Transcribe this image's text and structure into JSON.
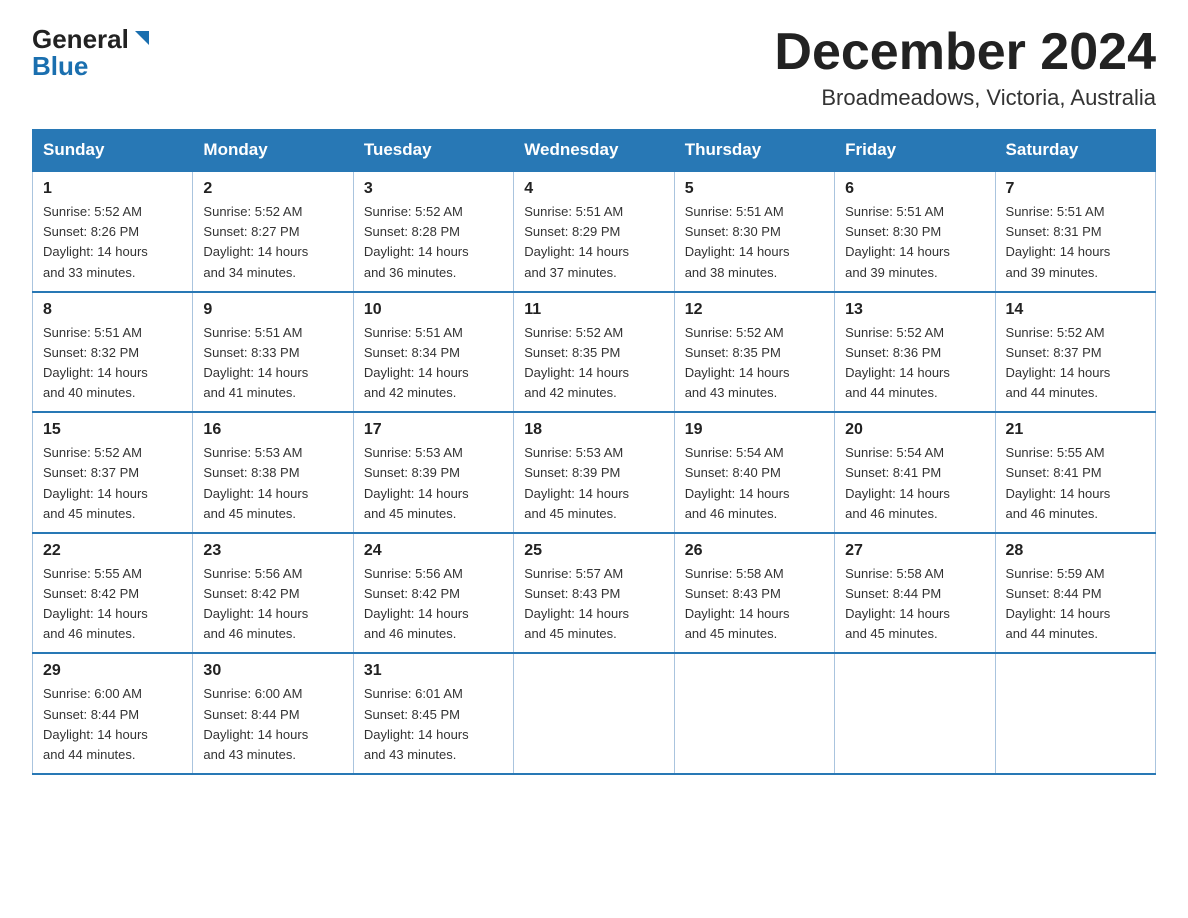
{
  "header": {
    "logo_general": "General",
    "logo_blue": "Blue",
    "month_title": "December 2024",
    "location": "Broadmeadows, Victoria, Australia"
  },
  "weekdays": [
    "Sunday",
    "Monday",
    "Tuesday",
    "Wednesday",
    "Thursday",
    "Friday",
    "Saturday"
  ],
  "weeks": [
    [
      {
        "day": "1",
        "sunrise": "5:52 AM",
        "sunset": "8:26 PM",
        "daylight": "14 hours and 33 minutes."
      },
      {
        "day": "2",
        "sunrise": "5:52 AM",
        "sunset": "8:27 PM",
        "daylight": "14 hours and 34 minutes."
      },
      {
        "day": "3",
        "sunrise": "5:52 AM",
        "sunset": "8:28 PM",
        "daylight": "14 hours and 36 minutes."
      },
      {
        "day": "4",
        "sunrise": "5:51 AM",
        "sunset": "8:29 PM",
        "daylight": "14 hours and 37 minutes."
      },
      {
        "day": "5",
        "sunrise": "5:51 AM",
        "sunset": "8:30 PM",
        "daylight": "14 hours and 38 minutes."
      },
      {
        "day": "6",
        "sunrise": "5:51 AM",
        "sunset": "8:30 PM",
        "daylight": "14 hours and 39 minutes."
      },
      {
        "day": "7",
        "sunrise": "5:51 AM",
        "sunset": "8:31 PM",
        "daylight": "14 hours and 39 minutes."
      }
    ],
    [
      {
        "day": "8",
        "sunrise": "5:51 AM",
        "sunset": "8:32 PM",
        "daylight": "14 hours and 40 minutes."
      },
      {
        "day": "9",
        "sunrise": "5:51 AM",
        "sunset": "8:33 PM",
        "daylight": "14 hours and 41 minutes."
      },
      {
        "day": "10",
        "sunrise": "5:51 AM",
        "sunset": "8:34 PM",
        "daylight": "14 hours and 42 minutes."
      },
      {
        "day": "11",
        "sunrise": "5:52 AM",
        "sunset": "8:35 PM",
        "daylight": "14 hours and 42 minutes."
      },
      {
        "day": "12",
        "sunrise": "5:52 AM",
        "sunset": "8:35 PM",
        "daylight": "14 hours and 43 minutes."
      },
      {
        "day": "13",
        "sunrise": "5:52 AM",
        "sunset": "8:36 PM",
        "daylight": "14 hours and 44 minutes."
      },
      {
        "day": "14",
        "sunrise": "5:52 AM",
        "sunset": "8:37 PM",
        "daylight": "14 hours and 44 minutes."
      }
    ],
    [
      {
        "day": "15",
        "sunrise": "5:52 AM",
        "sunset": "8:37 PM",
        "daylight": "14 hours and 45 minutes."
      },
      {
        "day": "16",
        "sunrise": "5:53 AM",
        "sunset": "8:38 PM",
        "daylight": "14 hours and 45 minutes."
      },
      {
        "day": "17",
        "sunrise": "5:53 AM",
        "sunset": "8:39 PM",
        "daylight": "14 hours and 45 minutes."
      },
      {
        "day": "18",
        "sunrise": "5:53 AM",
        "sunset": "8:39 PM",
        "daylight": "14 hours and 45 minutes."
      },
      {
        "day": "19",
        "sunrise": "5:54 AM",
        "sunset": "8:40 PM",
        "daylight": "14 hours and 46 minutes."
      },
      {
        "day": "20",
        "sunrise": "5:54 AM",
        "sunset": "8:41 PM",
        "daylight": "14 hours and 46 minutes."
      },
      {
        "day": "21",
        "sunrise": "5:55 AM",
        "sunset": "8:41 PM",
        "daylight": "14 hours and 46 minutes."
      }
    ],
    [
      {
        "day": "22",
        "sunrise": "5:55 AM",
        "sunset": "8:42 PM",
        "daylight": "14 hours and 46 minutes."
      },
      {
        "day": "23",
        "sunrise": "5:56 AM",
        "sunset": "8:42 PM",
        "daylight": "14 hours and 46 minutes."
      },
      {
        "day": "24",
        "sunrise": "5:56 AM",
        "sunset": "8:42 PM",
        "daylight": "14 hours and 46 minutes."
      },
      {
        "day": "25",
        "sunrise": "5:57 AM",
        "sunset": "8:43 PM",
        "daylight": "14 hours and 45 minutes."
      },
      {
        "day": "26",
        "sunrise": "5:58 AM",
        "sunset": "8:43 PM",
        "daylight": "14 hours and 45 minutes."
      },
      {
        "day": "27",
        "sunrise": "5:58 AM",
        "sunset": "8:44 PM",
        "daylight": "14 hours and 45 minutes."
      },
      {
        "day": "28",
        "sunrise": "5:59 AM",
        "sunset": "8:44 PM",
        "daylight": "14 hours and 44 minutes."
      }
    ],
    [
      {
        "day": "29",
        "sunrise": "6:00 AM",
        "sunset": "8:44 PM",
        "daylight": "14 hours and 44 minutes."
      },
      {
        "day": "30",
        "sunrise": "6:00 AM",
        "sunset": "8:44 PM",
        "daylight": "14 hours and 43 minutes."
      },
      {
        "day": "31",
        "sunrise": "6:01 AM",
        "sunset": "8:45 PM",
        "daylight": "14 hours and 43 minutes."
      },
      null,
      null,
      null,
      null
    ]
  ],
  "labels": {
    "sunrise": "Sunrise:",
    "sunset": "Sunset:",
    "daylight": "Daylight:"
  }
}
